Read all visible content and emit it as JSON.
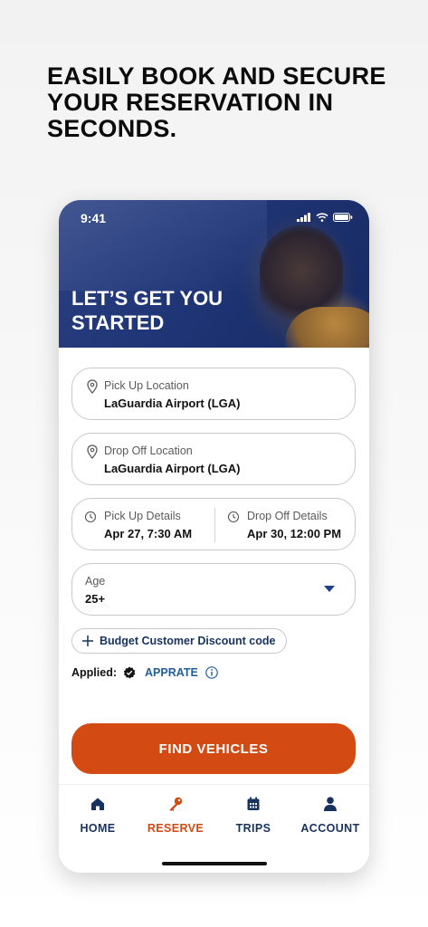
{
  "headline": "EASILY BOOK AND SECURE YOUR RESERVATION IN SECONDS.",
  "status_bar": {
    "time": "9:41"
  },
  "hero": {
    "title": "LET’S GET YOU STARTED"
  },
  "pickup_location": {
    "label": "Pick Up Location",
    "value": "LaGuardia Airport (LGA)"
  },
  "dropoff_location": {
    "label": "Drop Off Location",
    "value": "LaGuardia Airport (LGA)"
  },
  "pickup_details": {
    "label": "Pick Up Details",
    "value": "Apr 27, 7:30 AM"
  },
  "dropoff_details": {
    "label": "Drop Off Details",
    "value": "Apr 30, 12:00 PM"
  },
  "age": {
    "label": "Age",
    "value": "25+"
  },
  "discount": {
    "label": "Budget Customer Discount code"
  },
  "applied": {
    "label": "Applied:",
    "code": "APPRATE"
  },
  "cta": {
    "label": "FIND VEHICLES"
  },
  "tabs": [
    {
      "label": "HOME",
      "icon": "home-icon"
    },
    {
      "label": "RESERVE",
      "icon": "key-icon",
      "active": true
    },
    {
      "label": "TRIPS",
      "icon": "calendar-icon"
    },
    {
      "label": "ACCOUNT",
      "icon": "person-icon"
    }
  ],
  "colors": {
    "brand_navy": "#17325f",
    "accent_orange": "#d34a12",
    "link_blue": "#1f5f9c"
  }
}
